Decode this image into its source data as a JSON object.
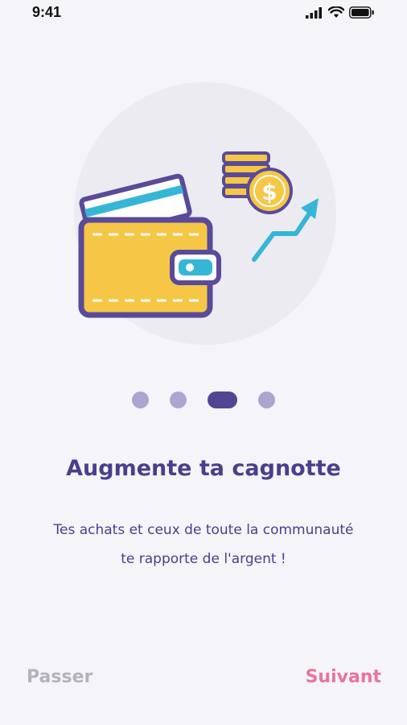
{
  "status_bar": {
    "time": "9:41"
  },
  "pager": {
    "total": 4,
    "active_index": 2
  },
  "content": {
    "title": "Augmente ta cagnotte",
    "subtitle_line1": "Tes achats et ceux de toute la communauté",
    "subtitle_line2": "te rapporte de l'argent !"
  },
  "nav": {
    "skip_label": "Passer",
    "next_label": "Suivant"
  },
  "illustration": {
    "coin_symbol": "$"
  },
  "colors": {
    "primary": "#4a3f8c",
    "accent_pink": "#e9759a",
    "wallet_yellow": "#f6c646",
    "wallet_outline": "#5a4a9a",
    "teal": "#36b6d6",
    "background": "#f4f4f9",
    "circle_bg": "#ebebf1"
  }
}
